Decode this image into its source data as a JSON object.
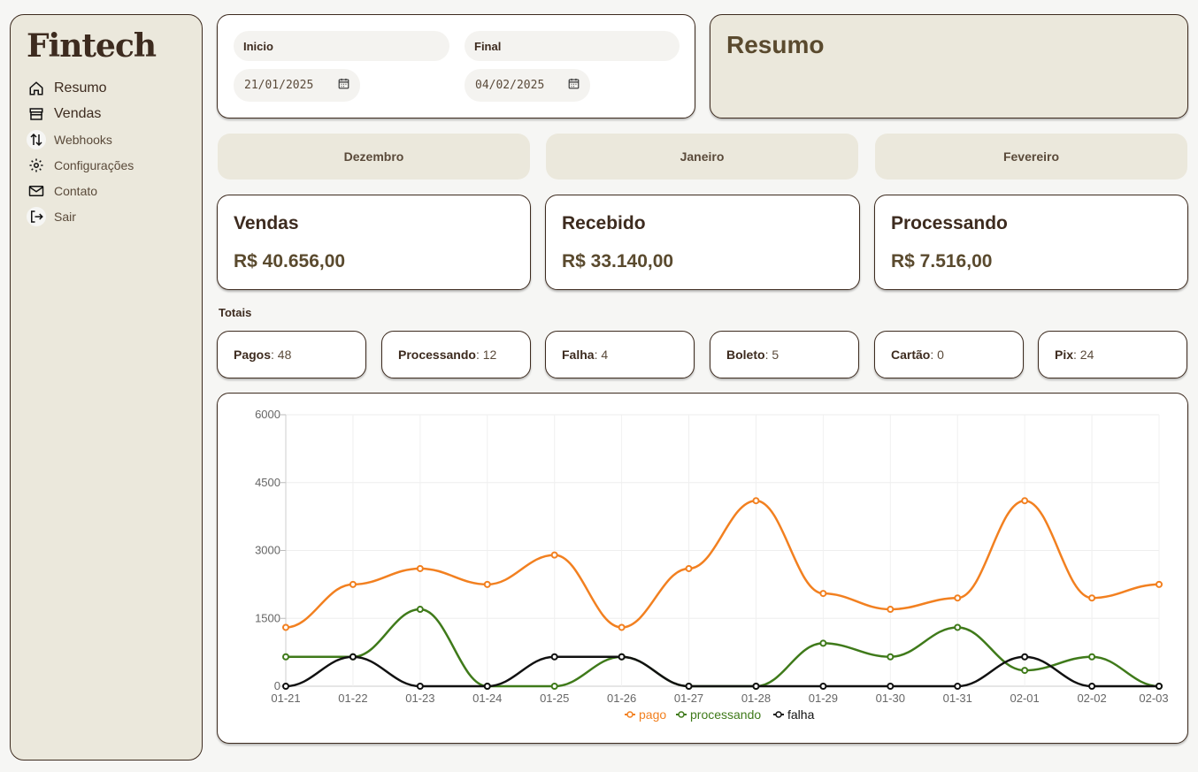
{
  "sidebar": {
    "logo": "Fintech",
    "items": [
      {
        "label": "Resumo",
        "icon": "home-icon"
      },
      {
        "label": "Vendas",
        "icon": "store-icon"
      },
      {
        "label": "Webhooks",
        "icon": "arrows-up-down-icon"
      },
      {
        "label": "Configurações",
        "icon": "gear-icon"
      },
      {
        "label": "Contato",
        "icon": "mail-icon"
      },
      {
        "label": "Sair",
        "icon": "logout-icon"
      }
    ]
  },
  "filters": {
    "start_label": "Inicio",
    "start_value": "21/01/2025",
    "end_label": "Final",
    "end_value": "04/02/2025"
  },
  "header": {
    "title": "Resumo"
  },
  "months": [
    "Dezembro",
    "Janeiro",
    "Fevereiro"
  ],
  "stats": [
    {
      "title": "Vendas",
      "value": "R$ 40.656,00"
    },
    {
      "title": "Recebido",
      "value": "R$ 33.140,00"
    },
    {
      "title": "Processando",
      "value": "R$ 7.516,00"
    }
  ],
  "totals": {
    "label": "Totais",
    "items": [
      {
        "label": "Pagos",
        "value": ": 48"
      },
      {
        "label": "Processando",
        "value": ": 12"
      },
      {
        "label": "Falha",
        "value": ": 4"
      },
      {
        "label": "Boleto",
        "value": ": 5"
      },
      {
        "label": "Cartão",
        "value": ": 0"
      },
      {
        "label": "Pix",
        "value": ": 24"
      }
    ]
  },
  "chart_data": {
    "type": "line",
    "x": [
      "01-21",
      "01-22",
      "01-23",
      "01-24",
      "01-25",
      "01-26",
      "01-27",
      "01-28",
      "01-29",
      "01-30",
      "01-31",
      "02-01",
      "02-02",
      "02-03"
    ],
    "ylim": [
      0,
      6000
    ],
    "yticks": [
      0,
      1500,
      3000,
      4500,
      6000
    ],
    "grid": true,
    "legend_position": "bottom",
    "series": [
      {
        "name": "pago",
        "color": "#f28020",
        "values": [
          1300,
          2250,
          2600,
          2250,
          2900,
          1300,
          2600,
          4100,
          2050,
          1700,
          1950,
          4100,
          1950,
          2250
        ]
      },
      {
        "name": "processando",
        "color": "#3f7a1a",
        "values": [
          650,
          650,
          1700,
          0,
          0,
          650,
          0,
          0,
          950,
          650,
          1300,
          350,
          650,
          0
        ]
      },
      {
        "name": "falha",
        "color": "#111111",
        "values": [
          0,
          650,
          0,
          0,
          650,
          650,
          0,
          0,
          0,
          0,
          0,
          650,
          0,
          0
        ]
      }
    ]
  }
}
